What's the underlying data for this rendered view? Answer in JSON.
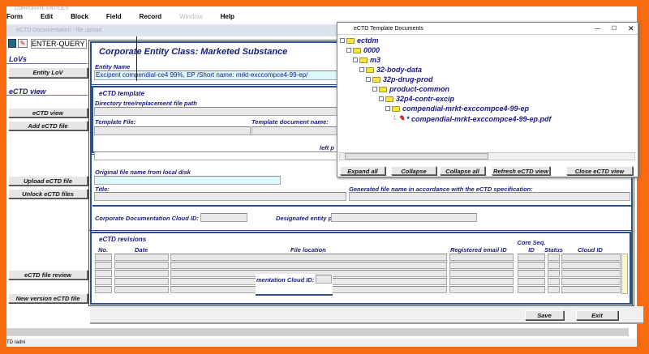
{
  "window_title": "CORPORATE ENTITIES",
  "menu": [
    "Form",
    "Edit",
    "Block",
    "Field",
    "Record",
    "Window",
    "Help"
  ],
  "mdi_title": "eCTD Documentation - file upload",
  "toolbar": {
    "mode": "ENTER-QUERY"
  },
  "left": {
    "lovs": "LoVs",
    "entity_lov": "Entity LoV",
    "ectd_view_header": "eCTD view",
    "ectd_view": "eCTD view",
    "add_file": "Add eCTD file",
    "upload": "Upload eCTD file",
    "unlock": "Unlock eCTD files",
    "review": "eCTD file review",
    "new_version": "New version eCTD file"
  },
  "main": {
    "title": "Corporate Entity Class: Marketed Substance",
    "entity_name_label": "Entity Name",
    "entity_name": "Excipent compendial-ce4 99%, EP    /Short  name: mrkt-exccompce4-99-ep/",
    "template_header": "eCTD template",
    "dir_label": "Directory tree/replacement file path",
    "template_file_label": "Template File:",
    "template_doc_label": "Template document name:",
    "left_p": "left p",
    "orig_label": "Original file name from local disk",
    "title_label": "Title:",
    "generated_label": "Generated file name in accordance with the eCTD specification:",
    "cloud_label": "Corporate Documentation Cloud ID:",
    "person_label": "Designated entity person:",
    "revisions_header": "eCTD revisions",
    "columns": [
      "No.",
      "Date",
      "File location",
      "Registered email ID",
      "Core Seq. ID",
      "Status",
      "Cloud ID"
    ],
    "overlay_label": "mentation Cloud ID:",
    "save": "Save",
    "exit": "Exit"
  },
  "status": "TD radni",
  "popup": {
    "title": "eCTD Template Documents",
    "tree": [
      "ectdm",
      "0000",
      "m3",
      "32-body-data",
      "32p-drug-prod",
      "product-common",
      "32p4-contr-excip",
      "compendial-mrkt-exccompce4-99-ep",
      "* compendial-mrkt-exccompce4-99-ep.pdf"
    ],
    "buttons": [
      "Expand all",
      "Collapse",
      "Collapse all",
      "Refresh eCTD view",
      "Close eCTD view"
    ]
  }
}
